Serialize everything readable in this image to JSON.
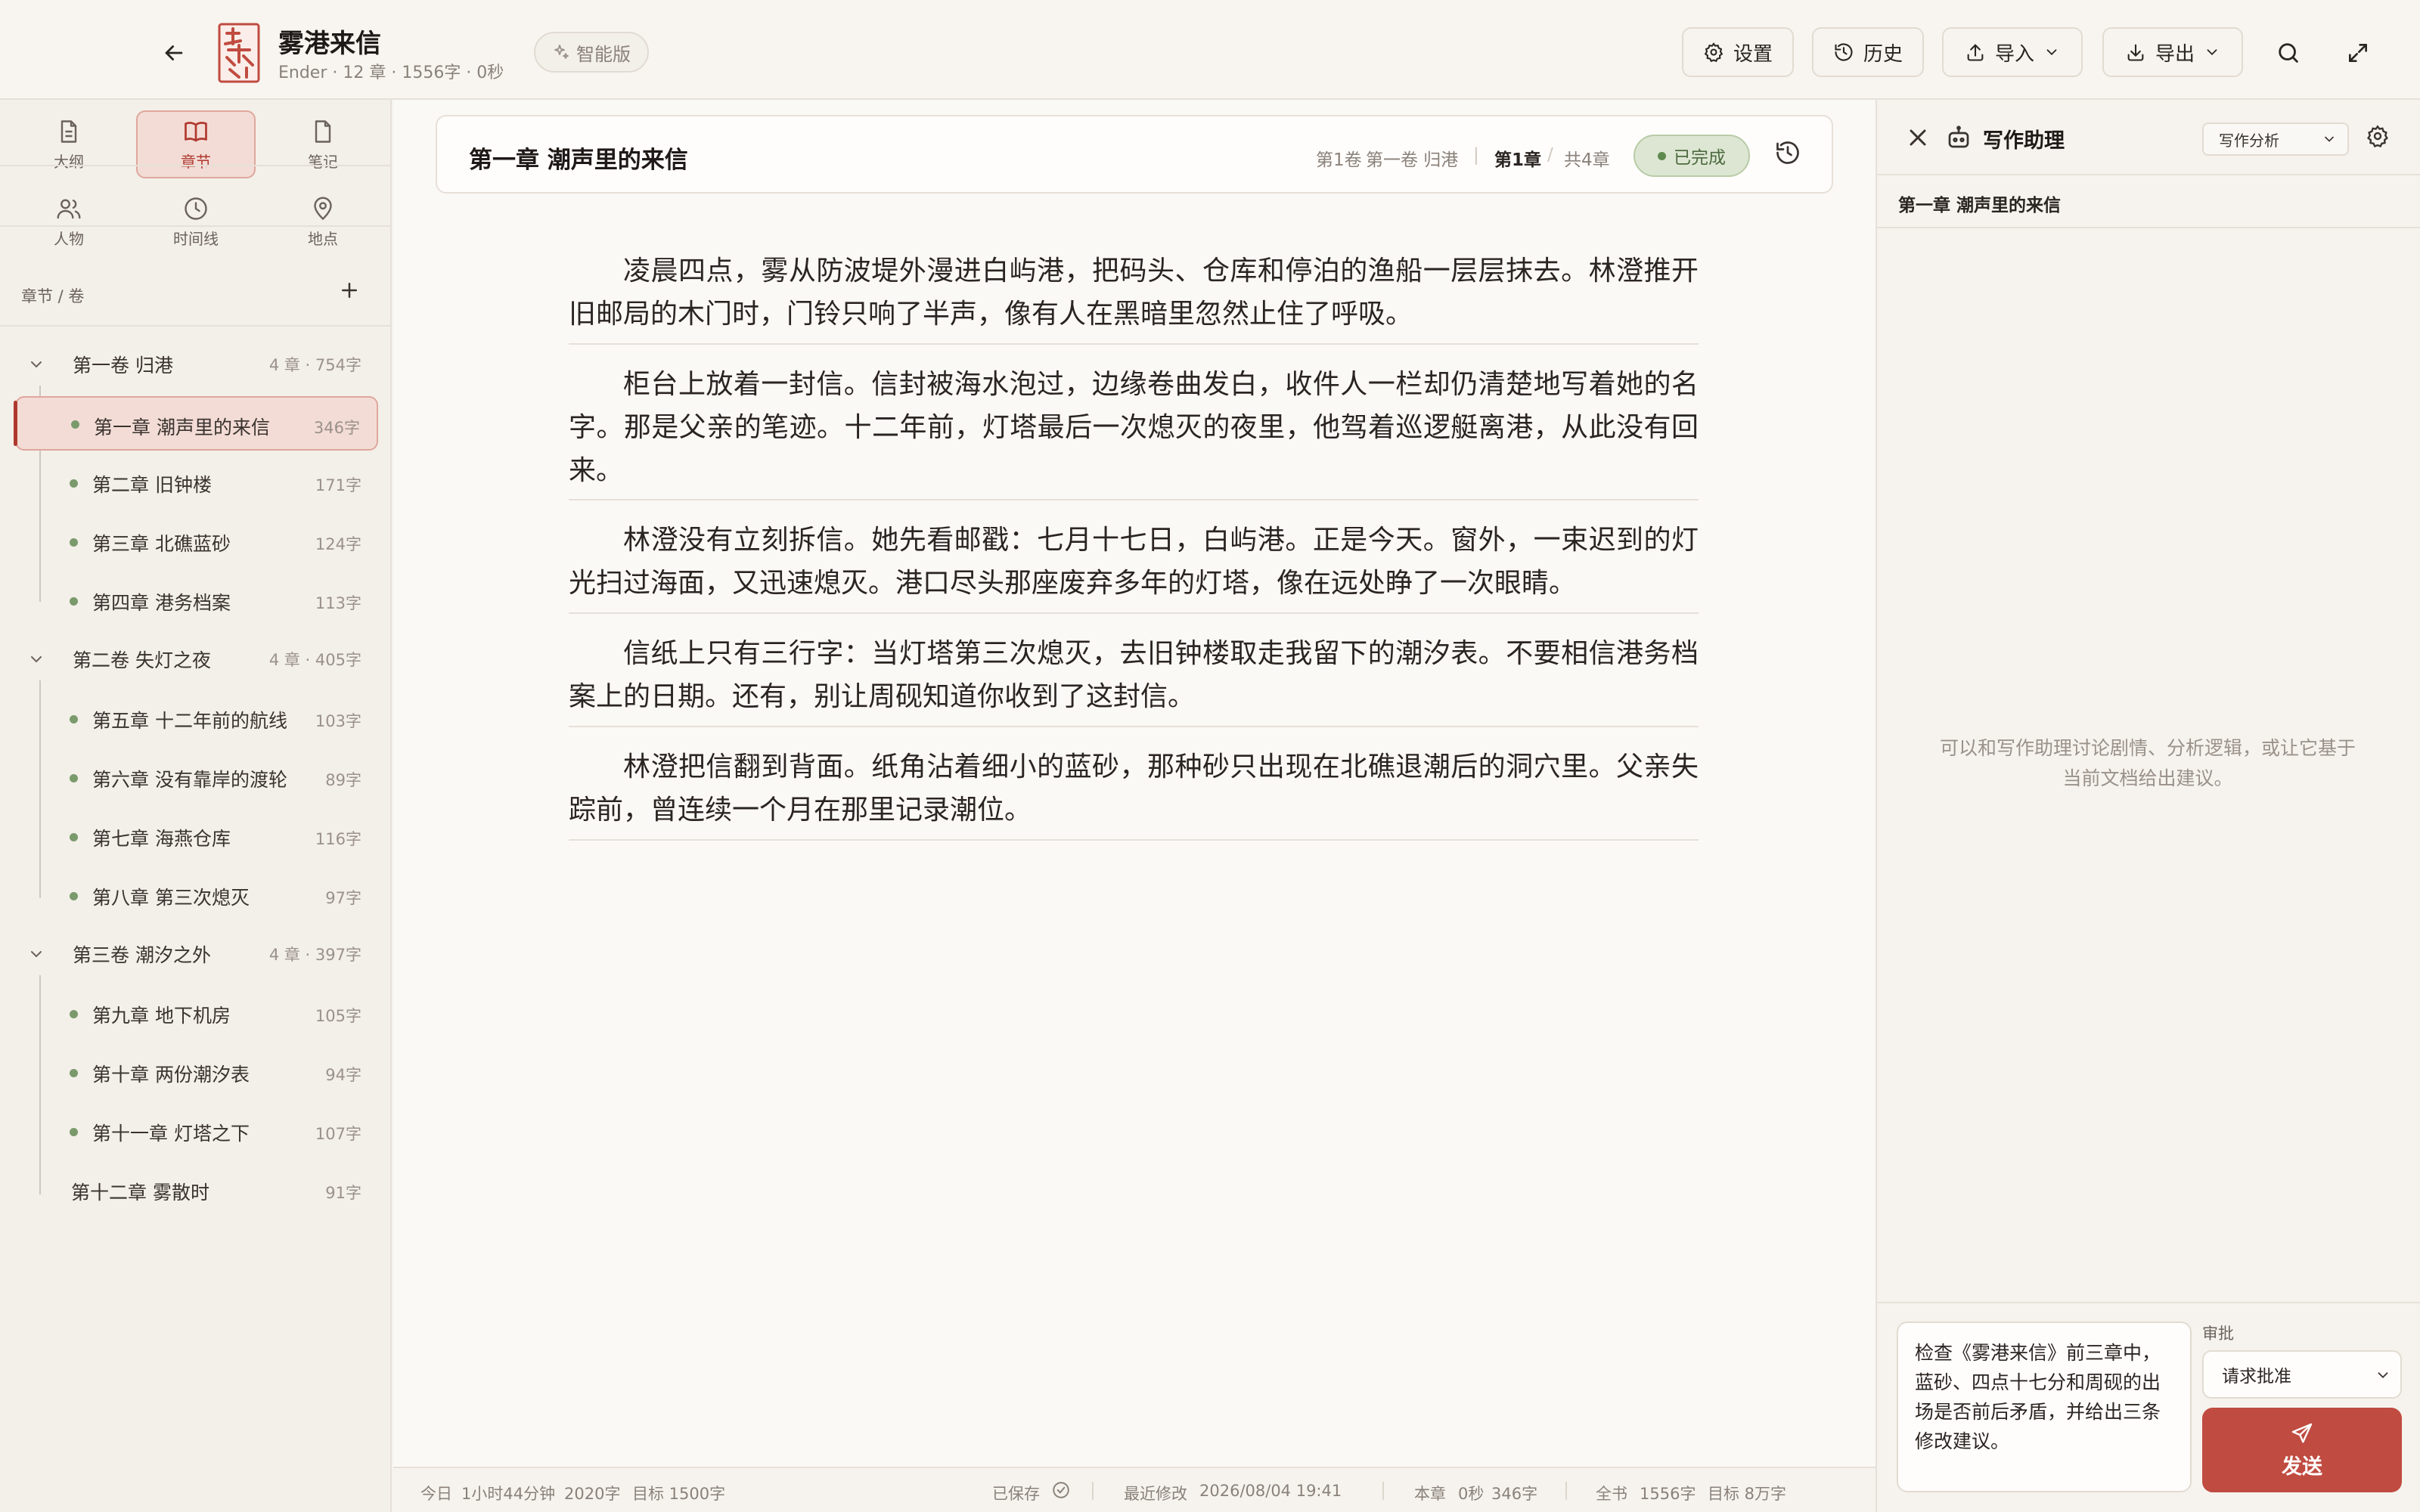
{
  "header": {
    "book_title": "雾港来信",
    "book_meta": "Ender · 12 章 · 1556字 · 0秒",
    "edition": "智能版",
    "buttons": {
      "settings": "设置",
      "history": "历史",
      "import": "导入",
      "export": "导出"
    }
  },
  "nav": {
    "tiles": [
      {
        "label": "大纲",
        "icon": "outline-icon"
      },
      {
        "label": "章节",
        "icon": "book-icon"
      },
      {
        "label": "笔记",
        "icon": "note-icon"
      },
      {
        "label": "人物",
        "icon": "people-icon"
      },
      {
        "label": "时间线",
        "icon": "clock-icon"
      },
      {
        "label": "地点",
        "icon": "map-pin-icon"
      }
    ],
    "active": "章节"
  },
  "tree": {
    "header": "章节 / 卷",
    "volumes": [
      {
        "name": "第一卷 归港",
        "stats": "4 章 · 754字",
        "chapters": [
          {
            "title": "第一章 潮声里的来信",
            "count": "346字",
            "active": true
          },
          {
            "title": "第二章 旧钟楼",
            "count": "171字"
          },
          {
            "title": "第三章 北礁蓝砂",
            "count": "124字"
          },
          {
            "title": "第四章 港务档案",
            "count": "113字"
          }
        ]
      },
      {
        "name": "第二卷 失灯之夜",
        "stats": "4 章 · 405字",
        "chapters": [
          {
            "title": "第五章 十二年前的航线",
            "count": "103字"
          },
          {
            "title": "第六章 没有靠岸的渡轮",
            "count": "89字"
          },
          {
            "title": "第七章 海燕仓库",
            "count": "116字"
          },
          {
            "title": "第八章 第三次熄灭",
            "count": "97字"
          }
        ]
      },
      {
        "name": "第三卷 潮汐之外",
        "stats": "4 章 · 397字",
        "chapters": [
          {
            "title": "第九章 地下机房",
            "count": "105字"
          },
          {
            "title": "第十章 两份潮汐表",
            "count": "94字"
          },
          {
            "title": "第十一章 灯塔之下",
            "count": "107字"
          },
          {
            "title": "第十二章 雾散时",
            "count": "91字"
          }
        ]
      }
    ]
  },
  "chapter": {
    "title": "第一章 潮声里的来信",
    "volume_label": "第1卷",
    "volume_name": "第一卷 归港",
    "chapter_no": "第1章",
    "total": "共4章",
    "status": "已完成",
    "paragraphs": [
      "凌晨四点，雾从防波堤外漫进白屿港，把码头、仓库和停泊的渔船一层层抹去。林澄推开旧邮局的木门时，门铃只响了半声，像有人在黑暗里忽然止住了呼吸。",
      "柜台上放着一封信。信封被海水泡过，边缘卷曲发白，收件人一栏却仍清楚地写着她的名字。那是父亲的笔迹。十二年前，灯塔最后一次熄灭的夜里，他驾着巡逻艇离港，从此没有回来。",
      "林澄没有立刻拆信。她先看邮戳：七月十七日，白屿港。正是今天。窗外，一束迟到的灯光扫过海面，又迅速熄灭。港口尽头那座废弃多年的灯塔，像在远处睁了一次眼睛。",
      "信纸上只有三行字：当灯塔第三次熄灭，去旧钟楼取走我留下的潮汐表。不要相信港务档案上的日期。还有，别让周砚知道你收到了这封信。",
      "林澄把信翻到背面。纸角沾着细小的蓝砂，那种砂只出现在北礁退潮后的洞穴里。父亲失踪前，曾连续一个月在那里记录潮位。"
    ]
  },
  "statusbar": {
    "today_label": "今日",
    "today_time": "1小时44分钟",
    "today_words": "2020字",
    "today_target": "目标 1500字",
    "saved": "已保存",
    "last_modified_label": "最近修改",
    "last_modified": "2026/08/04 19:41",
    "chapter_label": "本章",
    "chapter_time": "0秒",
    "chapter_words": "346字",
    "book_label": "全书",
    "book_words": "1556字",
    "book_target": "目标 8万字"
  },
  "assistant": {
    "title": "写作助理",
    "mode": "写作分析",
    "context": "第一章 潮声里的来信",
    "empty_hint": "可以和写作助理讨论剧情、分析逻辑，或让它基于当前文档给出建议。",
    "input_text": "检查《雾港来信》前三章中，蓝砂、四点十七分和周砚的出场是否前后矛盾，并给出三条修改建议。",
    "approval_label": "审批",
    "approval_value": "请求批准",
    "send": "发送"
  },
  "colors": {
    "accent": "#c04b40",
    "background": "#f6f3ee",
    "done_green": "#5f8a4d"
  }
}
